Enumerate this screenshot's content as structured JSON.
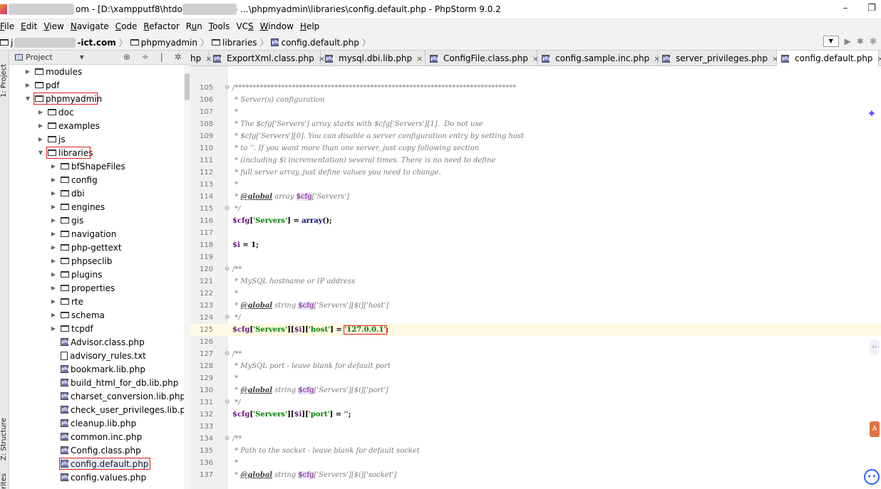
{
  "window": {
    "title": "om - [D:\\xampputf8\\htdocs\\                ict.com] - ...\\phpmyadmin\\libraries\\config.default.php - PhpStorm 9.0.2",
    "minimize_glyph": "–",
    "restore_glyph": "❐"
  },
  "menu": [
    {
      "u": "F",
      "rest": "ile"
    },
    {
      "u": "E",
      "rest": "dit"
    },
    {
      "u": "V",
      "rest": "iew"
    },
    {
      "u": "N",
      "rest": "avigate"
    },
    {
      "u": "C",
      "rest": "ode"
    },
    {
      "u": "R",
      "rest": "efactor"
    },
    {
      "pre": "R",
      "u": "u",
      "rest": "n"
    },
    {
      "u": "T",
      "rest": "ools"
    },
    {
      "pre": "VC",
      "u": "S",
      "rest": ""
    },
    {
      "u": "W",
      "rest": "indow"
    },
    {
      "u": "H",
      "rest": "elp"
    }
  ],
  "breadcrumb": {
    "root_prefix": "j",
    "root_suffix": "-ict.com",
    "items": [
      "phpmyadmin",
      "libraries",
      "config.default.php"
    ]
  },
  "project_panel": {
    "title": "Project",
    "tools": "⊕ ÷ | ✲ |←",
    "tree": [
      {
        "label": "modules",
        "type": "folder",
        "depth": 0,
        "state": "collapsed"
      },
      {
        "label": "pdf",
        "type": "folder",
        "depth": 0,
        "state": "collapsed"
      },
      {
        "label": "phpmyadmin",
        "type": "folder",
        "depth": 0,
        "state": "expanded"
      },
      {
        "label": "doc",
        "type": "folder",
        "depth": 1,
        "state": "collapsed"
      },
      {
        "label": "examples",
        "type": "folder",
        "depth": 1,
        "state": "collapsed"
      },
      {
        "label": "js",
        "type": "folder",
        "depth": 1,
        "state": "collapsed"
      },
      {
        "label": "libraries",
        "type": "folder",
        "depth": 1,
        "state": "expanded"
      },
      {
        "label": "bfShapeFiles",
        "type": "folder",
        "depth": 2,
        "state": "collapsed"
      },
      {
        "label": "config",
        "type": "folder",
        "depth": 2,
        "state": "collapsed"
      },
      {
        "label": "dbi",
        "type": "folder",
        "depth": 2,
        "state": "collapsed"
      },
      {
        "label": "engines",
        "type": "folder",
        "depth": 2,
        "state": "collapsed"
      },
      {
        "label": "gis",
        "type": "folder",
        "depth": 2,
        "state": "collapsed"
      },
      {
        "label": "navigation",
        "type": "folder",
        "depth": 2,
        "state": "collapsed"
      },
      {
        "label": "php-gettext",
        "type": "folder",
        "depth": 2,
        "state": "collapsed"
      },
      {
        "label": "phpseclib",
        "type": "folder",
        "depth": 2,
        "state": "collapsed"
      },
      {
        "label": "plugins",
        "type": "folder",
        "depth": 2,
        "state": "collapsed"
      },
      {
        "label": "properties",
        "type": "folder",
        "depth": 2,
        "state": "collapsed"
      },
      {
        "label": "rte",
        "type": "folder",
        "depth": 2,
        "state": "collapsed"
      },
      {
        "label": "schema",
        "type": "folder",
        "depth": 2,
        "state": "collapsed"
      },
      {
        "label": "tcpdf",
        "type": "folder",
        "depth": 2,
        "state": "collapsed"
      },
      {
        "label": "Advisor.class.php",
        "type": "php",
        "depth": 2
      },
      {
        "label": "advisory_rules.txt",
        "type": "txt",
        "depth": 2
      },
      {
        "label": "bookmark.lib.php",
        "type": "php",
        "depth": 2
      },
      {
        "label": "build_html_for_db.lib.php",
        "type": "php",
        "depth": 2
      },
      {
        "label": "charset_conversion.lib.php",
        "type": "php",
        "depth": 2
      },
      {
        "label": "check_user_privileges.lib.php",
        "type": "php",
        "depth": 2
      },
      {
        "label": "cleanup.lib.php",
        "type": "php",
        "depth": 2
      },
      {
        "label": "common.inc.php",
        "type": "php",
        "depth": 2
      },
      {
        "label": "Config.class.php",
        "type": "php",
        "depth": 2
      },
      {
        "label": "config.default.php",
        "type": "php",
        "depth": 2,
        "selected": true
      },
      {
        "label": "config.values.php",
        "type": "php",
        "depth": 2
      }
    ]
  },
  "side_labels": {
    "project": "1: Project",
    "structure": "Z: Structure",
    "favorites": "rites"
  },
  "tabs": [
    {
      "label": "hp",
      "icon": false
    },
    {
      "label": "ExportXml.class.php",
      "icon": true
    },
    {
      "label": "mysql.dbi.lib.php",
      "icon": true
    },
    {
      "label": "ConfigFile.class.php",
      "icon": true
    },
    {
      "label": "config.sample.inc.php",
      "icon": true
    },
    {
      "label": "server_privileges.php",
      "icon": true
    },
    {
      "label": "config.default.php",
      "icon": true,
      "active": true
    }
  ],
  "tab_close": "×",
  "code_lines": [
    {
      "n": "105",
      "fold": "⊖",
      "parts": [
        [
          "cm",
          "/*******************************************************************************"
        ]
      ]
    },
    {
      "n": "106",
      "parts": [
        [
          "cm",
          " * Server(s) configuration"
        ]
      ]
    },
    {
      "n": "107",
      "parts": [
        [
          "cm",
          " *"
        ]
      ]
    },
    {
      "n": "108",
      "parts": [
        [
          "cm",
          " * The $cfg['Servers'] array starts with $cfg['Servers'][1].  Do not use"
        ]
      ]
    },
    {
      "n": "109",
      "parts": [
        [
          "cm",
          " * $cfg['Servers'][0]. You can disable a server configuration entry by setting host"
        ]
      ]
    },
    {
      "n": "110",
      "parts": [
        [
          "cm",
          " * to ''. If you want more than one server, just copy following section"
        ]
      ]
    },
    {
      "n": "111",
      "parts": [
        [
          "cm",
          " * (including $i incrementation) several times. There is no need to define"
        ]
      ]
    },
    {
      "n": "112",
      "parts": [
        [
          "cm",
          " * full server array, just define values you need to change."
        ]
      ]
    },
    {
      "n": "113",
      "parts": [
        [
          "cm",
          " *"
        ]
      ]
    },
    {
      "n": "114",
      "parts": [
        [
          "cm",
          " * "
        ],
        [
          "tag",
          "@global"
        ],
        [
          "cm",
          " array "
        ],
        [
          "var-hl",
          "$cfg"
        ],
        [
          "cm",
          "['Servers']"
        ]
      ]
    },
    {
      "n": "115",
      "fold": "⊖",
      "parts": [
        [
          "cm",
          " */"
        ]
      ]
    },
    {
      "n": "116",
      "parts": [
        [
          "var",
          "$cfg"
        ],
        [
          "plain",
          "["
        ],
        [
          "str",
          "'Servers'"
        ],
        [
          "plain",
          "] = "
        ],
        [
          "kw",
          "array"
        ],
        [
          "plain",
          "();"
        ]
      ]
    },
    {
      "n": "117",
      "parts": []
    },
    {
      "n": "118",
      "parts": [
        [
          "var",
          "$i"
        ],
        [
          "plain",
          " = 1;"
        ]
      ]
    },
    {
      "n": "119",
      "parts": []
    },
    {
      "n": "120",
      "fold": "⊖",
      "parts": [
        [
          "cm",
          "/**"
        ]
      ]
    },
    {
      "n": "121",
      "parts": [
        [
          "cm",
          " * MySQL hostname or IP address"
        ]
      ]
    },
    {
      "n": "122",
      "parts": [
        [
          "cm",
          " *"
        ]
      ]
    },
    {
      "n": "123",
      "parts": [
        [
          "cm",
          " * "
        ],
        [
          "tag",
          "@global"
        ],
        [
          "cm",
          " string "
        ],
        [
          "var-hl",
          "$cfg"
        ],
        [
          "cm",
          "['Servers'][$i]['host']"
        ]
      ]
    },
    {
      "n": "124",
      "fold": "⊖",
      "parts": [
        [
          "cm",
          " */"
        ]
      ]
    },
    {
      "n": "125",
      "current": true,
      "parts": [
        [
          "var",
          "$cfg"
        ],
        [
          "plain",
          "["
        ],
        [
          "str",
          "'Servers'"
        ],
        [
          "plain",
          "]["
        ],
        [
          "var",
          "$i"
        ],
        [
          "plain",
          "]["
        ],
        [
          "str",
          "'host'"
        ],
        [
          "plain",
          "] = "
        ],
        [
          "str box",
          "'127.0.0.1'"
        ],
        [
          "plain",
          ";"
        ]
      ]
    },
    {
      "n": "126",
      "parts": []
    },
    {
      "n": "127",
      "fold": "⊖",
      "parts": [
        [
          "cm",
          "/**"
        ]
      ]
    },
    {
      "n": "128",
      "parts": [
        [
          "cm",
          " * MySQL port - leave blank for default port"
        ]
      ]
    },
    {
      "n": "129",
      "parts": [
        [
          "cm",
          " *"
        ]
      ]
    },
    {
      "n": "130",
      "parts": [
        [
          "cm",
          " * "
        ],
        [
          "tag",
          "@global"
        ],
        [
          "cm",
          " string "
        ],
        [
          "var-hl",
          "$cfg"
        ],
        [
          "cm",
          "['Servers'][$i]['port']"
        ]
      ]
    },
    {
      "n": "131",
      "fold": "⊖",
      "parts": [
        [
          "cm",
          " */"
        ]
      ]
    },
    {
      "n": "132",
      "parts": [
        [
          "var",
          "$cfg"
        ],
        [
          "plain",
          "["
        ],
        [
          "str",
          "'Servers'"
        ],
        [
          "plain",
          "]["
        ],
        [
          "var",
          "$i"
        ],
        [
          "plain",
          "]["
        ],
        [
          "str",
          "'port'"
        ],
        [
          "plain",
          "] = "
        ],
        [
          "str",
          "''"
        ],
        [
          "plain",
          ";"
        ]
      ]
    },
    {
      "n": "133",
      "parts": []
    },
    {
      "n": "134",
      "fold": "⊖",
      "parts": [
        [
          "cm",
          "/**"
        ]
      ]
    },
    {
      "n": "135",
      "parts": [
        [
          "cm",
          " * Path to the socket - leave blank for default socket"
        ]
      ]
    },
    {
      "n": "136",
      "parts": [
        [
          "cm",
          " *"
        ]
      ]
    },
    {
      "n": "137",
      "parts": [
        [
          "cm",
          " * "
        ],
        [
          "tag",
          "@global"
        ],
        [
          "cm",
          " string "
        ],
        [
          "var-hl",
          "$cfg"
        ],
        [
          "cm",
          "['Servers'][$i]['socket']"
        ]
      ]
    }
  ]
}
